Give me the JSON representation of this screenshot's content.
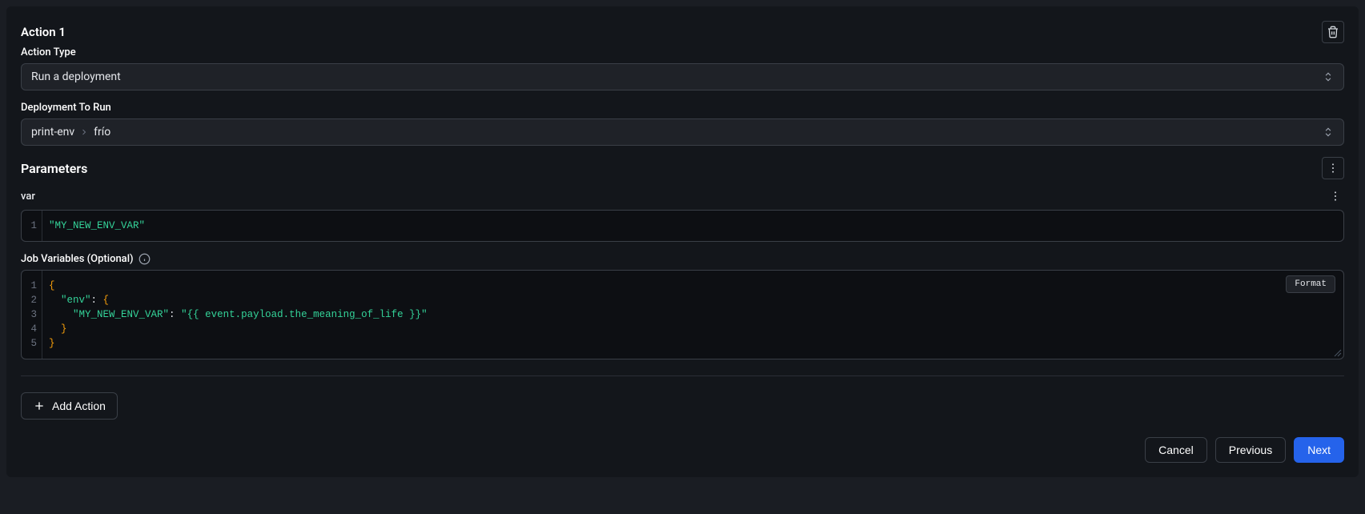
{
  "action": {
    "title": "Action 1",
    "typeLabel": "Action Type",
    "typeValue": "Run a deployment",
    "deploymentLabel": "Deployment To Run",
    "deploymentPath": {
      "a": "print-env",
      "b": "frío"
    }
  },
  "parameters": {
    "heading": "Parameters",
    "items": [
      {
        "name": "var",
        "code": {
          "lines": [
            "1"
          ],
          "tokens": [
            [
              {
                "t": "str",
                "v": "\"MY_NEW_ENV_VAR\""
              }
            ]
          ]
        }
      }
    ]
  },
  "jobVars": {
    "label": "Job Variables (Optional)",
    "formatLabel": "Format",
    "code": {
      "lines": [
        "1",
        "2",
        "3",
        "4",
        "5"
      ],
      "tokens": [
        [
          {
            "t": "brace",
            "v": "{"
          }
        ],
        [
          {
            "t": "plain",
            "v": "  "
          },
          {
            "t": "str",
            "v": "\"env\""
          },
          {
            "t": "punc",
            "v": ": "
          },
          {
            "t": "brace",
            "v": "{"
          }
        ],
        [
          {
            "t": "plain",
            "v": "    "
          },
          {
            "t": "str",
            "v": "\"MY_NEW_ENV_VAR\""
          },
          {
            "t": "punc",
            "v": ": "
          },
          {
            "t": "str",
            "v": "\"{{ event.payload.the_meaning_of_life }}\""
          }
        ],
        [
          {
            "t": "plain",
            "v": "  "
          },
          {
            "t": "brace",
            "v": "}"
          }
        ],
        [
          {
            "t": "brace",
            "v": "}"
          }
        ]
      ]
    }
  },
  "buttons": {
    "addAction": "Add Action",
    "cancel": "Cancel",
    "previous": "Previous",
    "next": "Next"
  }
}
